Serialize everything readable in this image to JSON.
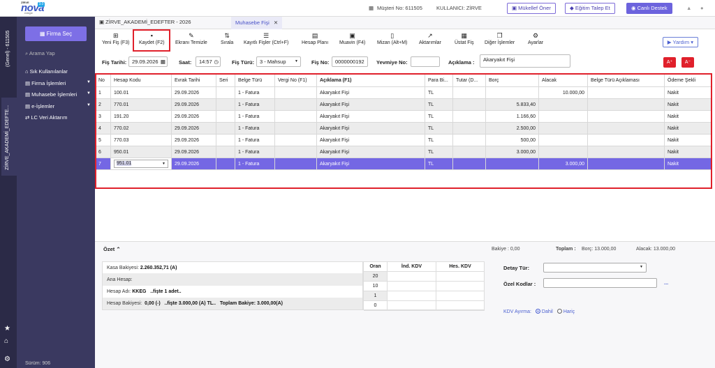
{
  "logo": {
    "brand": "ZİRVE",
    "name": "nova",
    "badge": "3.0",
    "sub": "entegre"
  },
  "header": {
    "musteri": "Müşteri No: 611505",
    "kullanici": "KULLANICI: ZİRVE",
    "btn1": "Mükellef Öner",
    "btn2": "Eğitim Talep Et",
    "btn3": "Canlı Destek"
  },
  "leftbar": {
    "company": "(Genel) - 611505",
    "tab": "ZİRVE_AKADEMİ_EDEFTE..."
  },
  "sidebar": {
    "firma_btn": "Firma Seç",
    "search": "Arama Yap",
    "items": [
      "Sık Kullanılanlar",
      "Firma İşlemleri",
      "Muhasebe İşlemleri",
      "e-İşlemler",
      "LC Veri Aktarım"
    ],
    "version": "Sürüm: 906"
  },
  "tabs": {
    "company": "ZİRVE_AKADEMİ_EDEFTER - 2026",
    "active": "Muhasebe Fişi"
  },
  "toolbar": {
    "items": [
      "Yeni Fiş (F3)",
      "Kaydet (F2)",
      "Ekranı Temizle",
      "Sırala",
      "Kayıtlı Fişler (Ctrl+F)",
      "Hesap Planı",
      "Muavin (F4)",
      "Mizan (Alt+M)",
      "Aktarımlar",
      "Üstat Fiş",
      "Diğer İşlemler",
      "Ayarlar"
    ],
    "help": "Yardım"
  },
  "form": {
    "tarih_lbl": "Fiş Tarihi:",
    "tarih": "29.09.2026",
    "saat_lbl": "Saat:",
    "saat": "14:57",
    "tur_lbl": "Fiş Türü:",
    "tur": "3 - Mahsup",
    "no_lbl": "Fiş No:",
    "no": "0000000192",
    "yev_lbl": "Yevmiye No:",
    "yev": "",
    "acik_lbl": "Açıklama :",
    "acik": "Akaryakıt Fişi",
    "aplus": "A⁺",
    "aminus": "A⁻"
  },
  "grid": {
    "headers": [
      "No",
      "Hesap Kodu",
      "Evrak Tarihi",
      "Seri",
      "Belge Türü",
      "Vergi No (F1)",
      "Açıklama (F1)",
      "Para Bi...",
      "Tutar (D...",
      "Borç",
      "Alacak",
      "Belge Türü Açıklaması",
      "Ödeme Şekli"
    ],
    "rows": [
      [
        "1",
        "100.01",
        "29.09.2026",
        "",
        "1 - Fatura",
        "",
        "Akaryakıt Fişi",
        "TL",
        "",
        "",
        "10.000,00",
        "",
        "Nakit"
      ],
      [
        "2",
        "770.01",
        "29.09.2026",
        "",
        "1 - Fatura",
        "",
        "Akaryakıt Fişi",
        "TL",
        "",
        "5.833,40",
        "",
        "",
        "Nakit"
      ],
      [
        "3",
        "191.20",
        "29.09.2026",
        "",
        "1 - Fatura",
        "",
        "Akaryakıt Fişi",
        "TL",
        "",
        "1.166,60",
        "",
        "",
        "Nakit"
      ],
      [
        "4",
        "770.02",
        "29.09.2026",
        "",
        "1 - Fatura",
        "",
        "Akaryakıt Fişi",
        "TL",
        "",
        "2.500,00",
        "",
        "",
        "Nakit"
      ],
      [
        "5",
        "770.03",
        "29.09.2026",
        "",
        "1 - Fatura",
        "",
        "Akaryakıt Fişi",
        "TL",
        "",
        "500,00",
        "",
        "",
        "Nakit"
      ],
      [
        "6",
        "950.01",
        "29.09.2026",
        "",
        "1 - Fatura",
        "",
        "Akaryakıt Fişi",
        "TL",
        "",
        "3.000,00",
        "",
        "",
        "Nakit"
      ],
      [
        "7",
        "951.01",
        "29.09.2026",
        "",
        "1 - Fatura",
        "",
        "Akaryakıt Fişi",
        "TL",
        "",
        "",
        "3.000,00",
        "",
        "Nakit"
      ]
    ]
  },
  "summary": {
    "title": "Özet",
    "bakiye": "Bakiye : 0,00",
    "toplam_lbl": "Toplam :",
    "borc": "Borç: 13.000,00",
    "alacak": "Alacak: 13.000,00",
    "kasa_lbl": "Kasa Bakiyesi:",
    "kasa": "2.260.352,71 (A)",
    "ana": "Ana Hesap:",
    "hesap_adi_lbl": "Hesap Adı:",
    "hesap_adi": "KKEG",
    "hesap_adi_note": "..fişte 1 adet..",
    "hb_lbl": "Hesap Bakiyesi:",
    "hb": "0,00 (-)",
    "hb_note": "..fişte 3.000,00 (A) TL..",
    "tb": "Toplam Bakiye: 3.000,00(A)",
    "kdv_headers": [
      "Oran",
      "İnd. KDV",
      "Hes. KDV"
    ],
    "oranlar": [
      "20",
      "10",
      "1",
      "0"
    ],
    "detay_lbl": "Detay Tür:",
    "ozel_lbl": "Özel Kodlar :",
    "ozel_more": "...",
    "kdv_lbl": "KDV Ayırma:",
    "dahil": "Dahil",
    "haric": "Hariç"
  }
}
